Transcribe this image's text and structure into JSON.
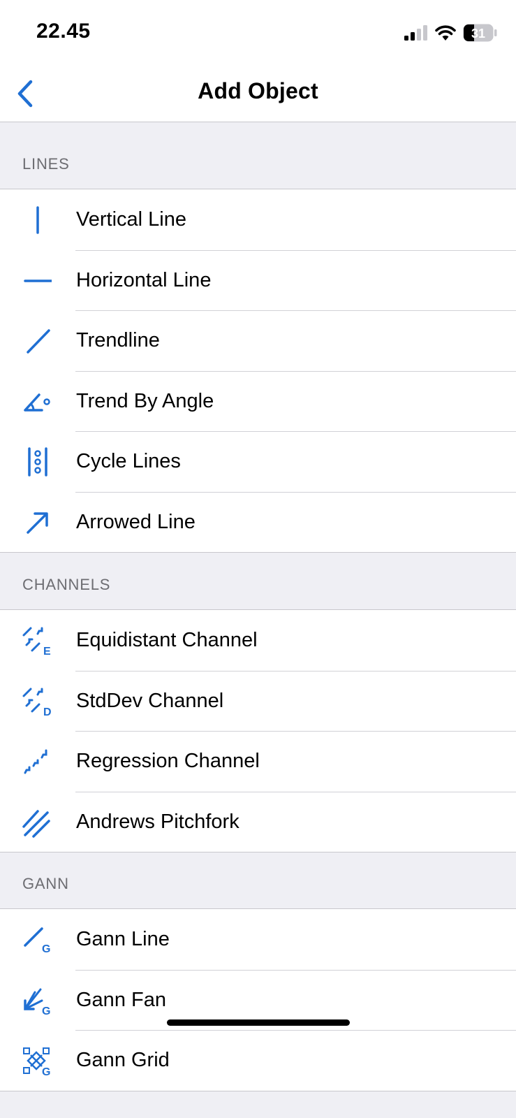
{
  "status": {
    "time": "22.45",
    "battery": "31"
  },
  "nav": {
    "title": "Add Object",
    "back_icon": "chevron-left-icon"
  },
  "sections": [
    {
      "header": "LINES",
      "items": [
        {
          "label": "Vertical Line",
          "icon": "vertical-line-icon"
        },
        {
          "label": "Horizontal Line",
          "icon": "horizontal-line-icon"
        },
        {
          "label": "Trendline",
          "icon": "trendline-icon"
        },
        {
          "label": "Trend By Angle",
          "icon": "trend-by-angle-icon"
        },
        {
          "label": "Cycle Lines",
          "icon": "cycle-lines-icon"
        },
        {
          "label": "Arrowed Line",
          "icon": "arrowed-line-icon"
        }
      ]
    },
    {
      "header": "CHANNELS",
      "items": [
        {
          "label": "Equidistant Channel",
          "icon": "equidistant-channel-icon"
        },
        {
          "label": "StdDev Channel",
          "icon": "stddev-channel-icon"
        },
        {
          "label": "Regression Channel",
          "icon": "regression-channel-icon"
        },
        {
          "label": "Andrews Pitchfork",
          "icon": "andrews-pitchfork-icon"
        }
      ]
    },
    {
      "header": "GANN",
      "items": [
        {
          "label": "Gann Line",
          "icon": "gann-line-icon"
        },
        {
          "label": "Gann Fan",
          "icon": "gann-fan-icon"
        },
        {
          "label": "Gann Grid",
          "icon": "gann-grid-icon"
        }
      ]
    }
  ],
  "colors": {
    "accent": "#1f6fd3",
    "background": "#efeff4",
    "separator": "#d1d1d6"
  }
}
